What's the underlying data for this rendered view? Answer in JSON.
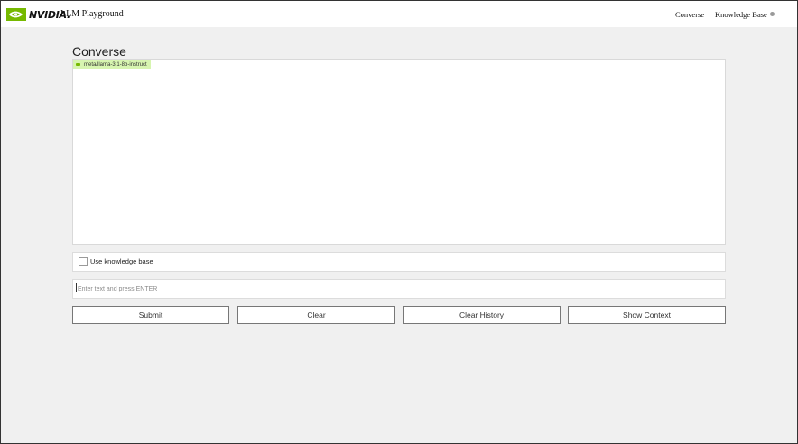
{
  "header": {
    "brand": "NVIDIA.",
    "app_title": "LLM Playground",
    "nav": [
      "Converse",
      "Knowledge Base"
    ],
    "accent_color": "#76b900"
  },
  "main": {
    "title": "Converse",
    "model_tag": "meta/llama-3.1-8b-instruct",
    "use_kb_label": "Use knowledge base",
    "use_kb_checked": false,
    "input_placeholder": "Enter text and press ENTER",
    "input_value": "",
    "buttons": {
      "submit": "Submit",
      "clear": "Clear",
      "clear_history": "Clear History",
      "show_context": "Show Context"
    }
  }
}
